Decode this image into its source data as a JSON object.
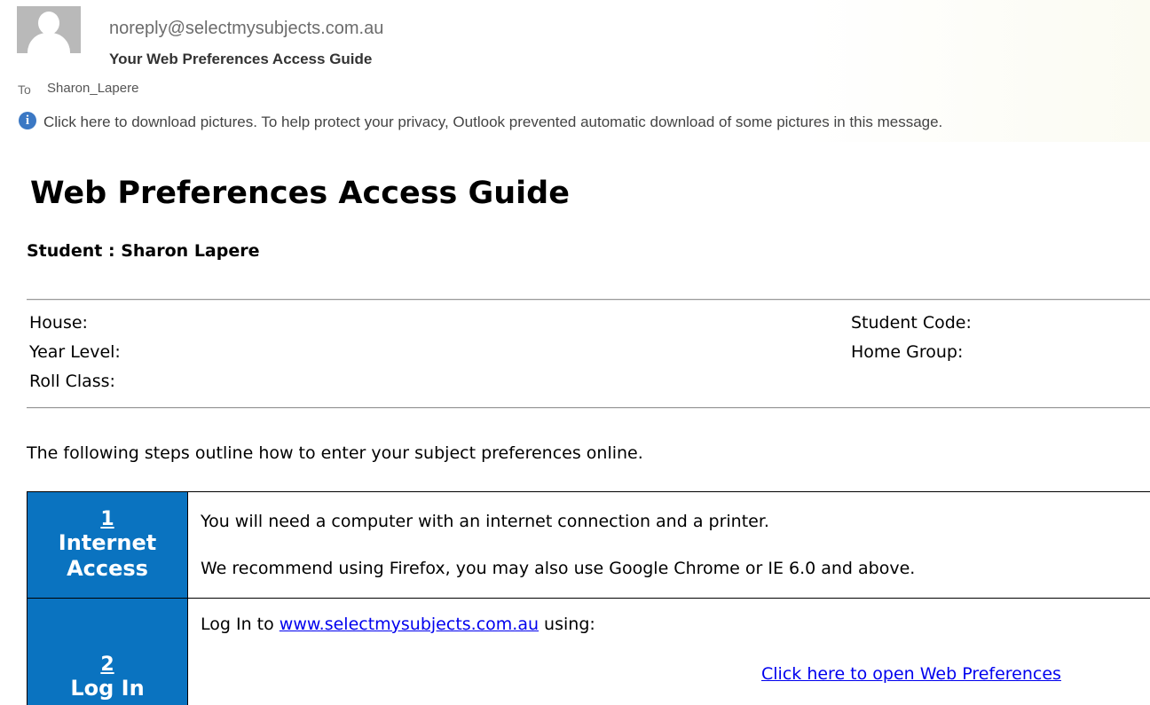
{
  "email": {
    "sender": "noreply@selectmysubjects.com.au",
    "subject": "Your Web Preferences Access Guide",
    "to_label": "To",
    "to_value": "Sharon_Lapere",
    "info_icon": "info-circle-icon",
    "info_text": "Click here to download pictures. To help protect your privacy, Outlook prevented automatic download of some pictures in this message."
  },
  "doc": {
    "title": "Web Preferences Access Guide",
    "student_line": "Student : Sharon Lapere",
    "fields_left": [
      "House:",
      "Year Level:",
      "Roll Class:"
    ],
    "fields_right": [
      "Student Code:",
      "Home Group:"
    ],
    "intro": "The following steps outline how to enter your subject preferences online."
  },
  "steps": [
    {
      "number": "1",
      "title_line1": "Internet",
      "title_line2": "Access",
      "text1": "You will need a computer with an internet connection and a printer.",
      "text2": "We recommend using Firefox, you may also use Google Chrome or IE 6.0 and above."
    },
    {
      "number": "2",
      "title_line1": "Log In",
      "text_prefix": "Log In to ",
      "link": "www.selectmysubjects.com.au",
      "text_suffix": " using:",
      "open_link": "Click here to open Web Preferences"
    }
  ],
  "colors": {
    "step_accent": "#0a73c0",
    "link": "#0000ee",
    "info_icon": "#3b78c4"
  }
}
